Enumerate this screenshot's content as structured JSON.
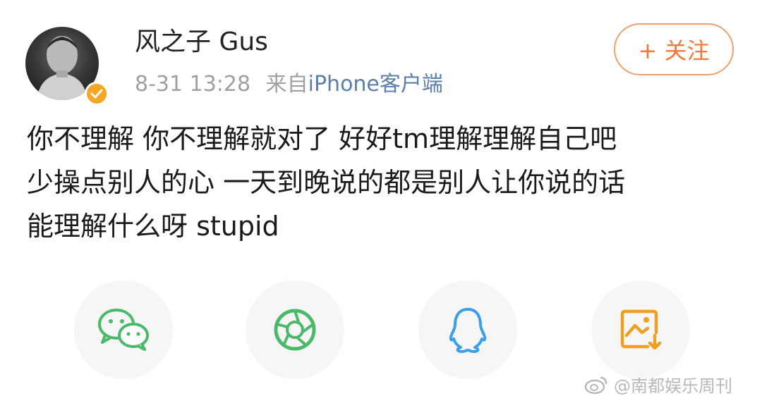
{
  "user": {
    "name": "风之子 Gus",
    "verified_icon": "verified-badge-icon"
  },
  "meta": {
    "timestamp": "8-31 13:28",
    "source_prefix": "来自",
    "source": "iPhone客户端"
  },
  "follow_button": {
    "label": "+ 关注"
  },
  "post": {
    "lines": [
      "你不理解 你不理解就对了 好好tm理解理解自己吧",
      "少操点别人的心 一天到晚说的都是别人让你说的话",
      "能理解什么呀 stupid"
    ]
  },
  "share": [
    {
      "icon": "wechat-icon",
      "color": "#4cb96a"
    },
    {
      "icon": "moments-icon",
      "color": "#4cb96a"
    },
    {
      "icon": "qq-icon",
      "color": "#3a9ee8"
    },
    {
      "icon": "save-image-icon",
      "color": "#f0a020"
    }
  ],
  "watermark": {
    "text": "@南都娱乐周刊"
  },
  "colors": {
    "accent_orange": "#f07a3a",
    "link_blue": "#5b7fa8",
    "meta_gray": "#a0a0a0"
  }
}
